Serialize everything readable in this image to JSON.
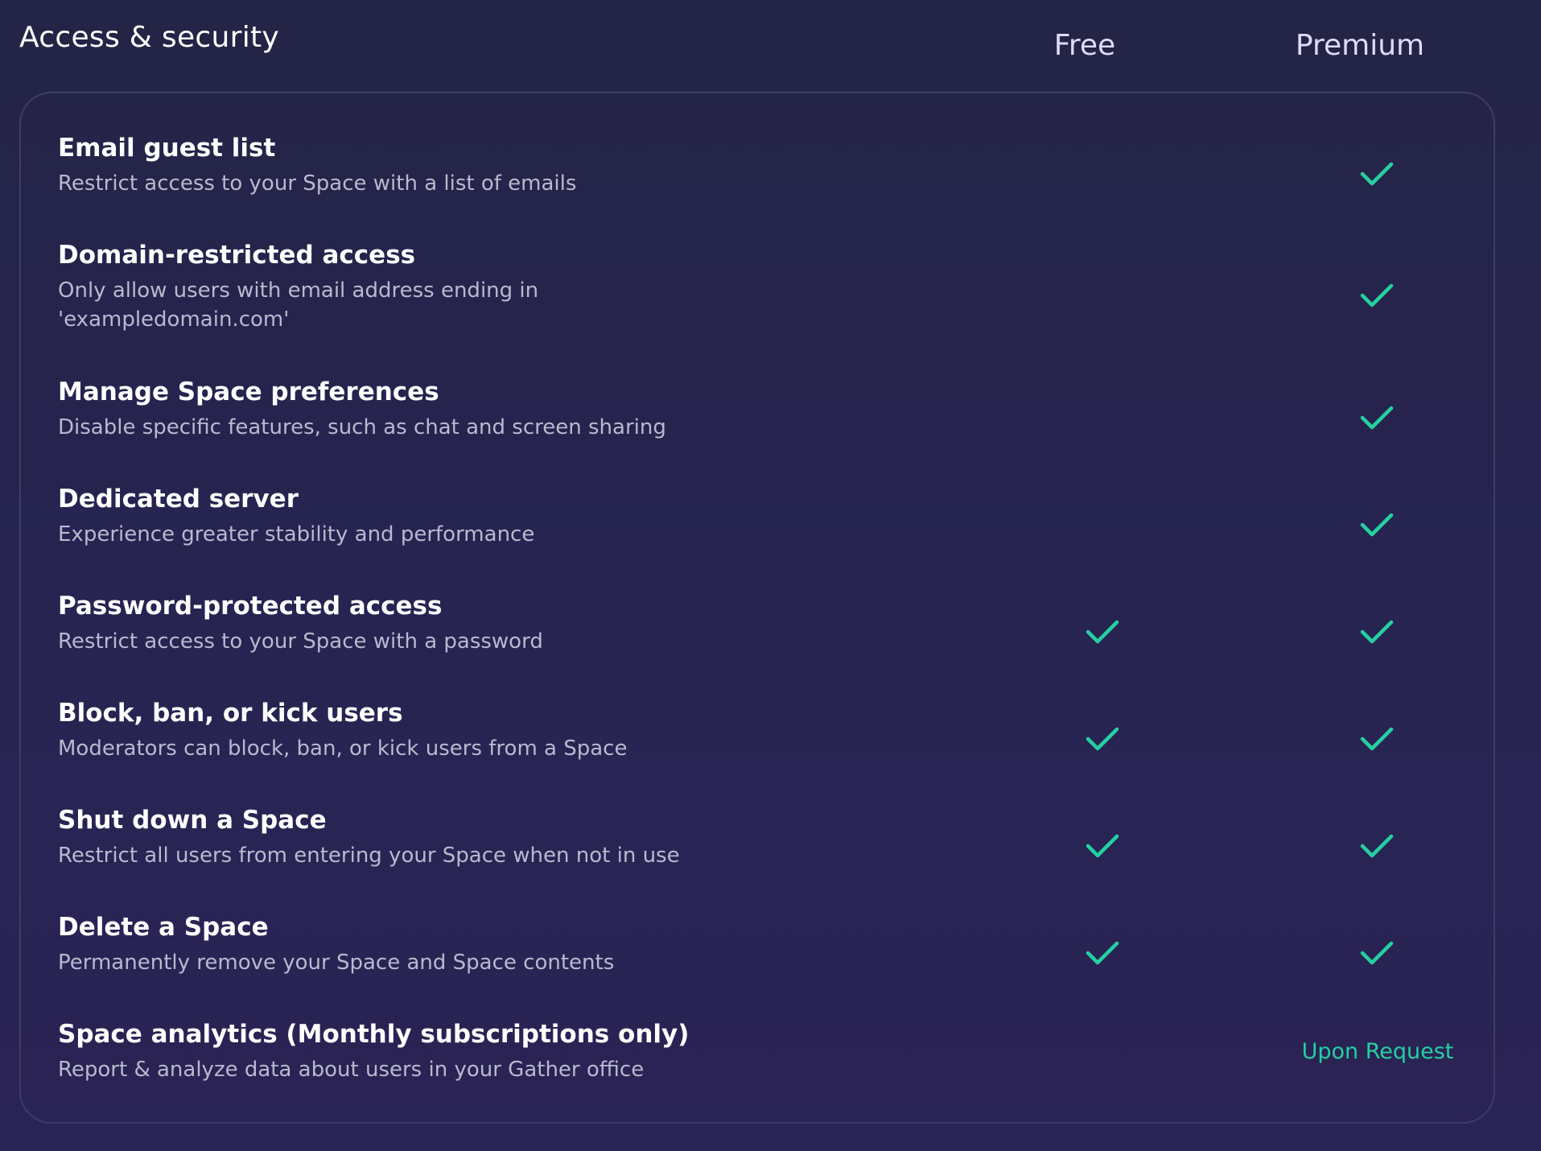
{
  "section": {
    "title": "Access & security"
  },
  "columns": {
    "free": "Free",
    "premium": "Premium"
  },
  "colors": {
    "background": "#262450",
    "check": "#25d0a0",
    "title_text": "#ffffff",
    "desc_text": "#b9b9cf",
    "border": "#3d3d66"
  },
  "features": [
    {
      "title": "Email guest list",
      "description": "Restrict access to your Space with a list of emails",
      "free": "none",
      "premium": "check-icon"
    },
    {
      "title": "Domain-restricted access",
      "description": "Only allow users with email address ending in 'exampledomain.com'",
      "free": "none",
      "premium": "check-icon"
    },
    {
      "title": "Manage Space preferences",
      "description": "Disable specific features, such as chat and screen sharing",
      "free": "none",
      "premium": "check-icon"
    },
    {
      "title": "Dedicated server",
      "description": "Experience greater stability and performance",
      "free": "none",
      "premium": "check-icon"
    },
    {
      "title": "Password-protected access",
      "description": "Restrict access to your Space with a password",
      "free": "check-icon",
      "premium": "check-icon"
    },
    {
      "title": "Block, ban, or kick users",
      "description": "Moderators can block, ban, or kick users from a Space",
      "free": "check-icon",
      "premium": "check-icon"
    },
    {
      "title": "Shut down a Space",
      "description": "Restrict all users from entering your Space when not in use",
      "free": "check-icon",
      "premium": "check-icon"
    },
    {
      "title": "Delete a Space",
      "description": "Permanently remove your Space and Space contents",
      "free": "check-icon",
      "premium": "check-icon"
    },
    {
      "title": "Space analytics (Monthly subscriptions only)",
      "description": "Report & analyze data about users in your Gather office",
      "free": "none",
      "premium": "Upon Request"
    }
  ]
}
